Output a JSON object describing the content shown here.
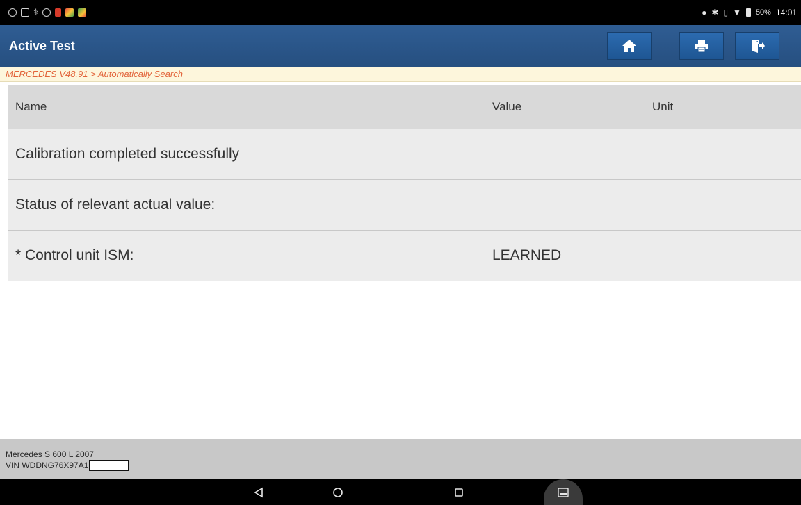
{
  "status_bar": {
    "left_icons": [
      "settings-icon",
      "screenshot-icon",
      "stethoscope-icon",
      "aperture-icon",
      "low-battery-icon",
      "app-icon",
      "app-icon"
    ],
    "right_icons": [
      "location-icon",
      "bluetooth-icon",
      "vibrate-icon",
      "wifi-icon",
      "battery-icon"
    ],
    "battery": "50%",
    "time": "14:01"
  },
  "header": {
    "title": "Active Test",
    "buttons": [
      "home-icon",
      "print-icon",
      "exit-icon"
    ]
  },
  "breadcrumb": "MERCEDES V48.91 > Automatically Search",
  "table": {
    "columns": [
      "Name",
      "Value",
      "Unit"
    ],
    "rows": [
      [
        "Calibration completed successfully",
        "",
        ""
      ],
      [
        "Status of relevant actual value:",
        "",
        ""
      ],
      [
        "* Control unit ISM:",
        "LEARNED",
        ""
      ]
    ]
  },
  "footer": {
    "vehicle": "Mercedes S 600 L 2007",
    "vin": "VIN WDDNG76X97A1"
  },
  "nav_bar": [
    "back-icon",
    "home-circle-icon",
    "recents-icon",
    "gallery-icon"
  ],
  "colors": {
    "header_bg": "#2a5687",
    "breadcrumb_text": "#e2633a",
    "breadcrumb_bg": "#fdf6dc",
    "table_header_bg": "#d9d9d9",
    "table_row_bg": "#ececec",
    "footer_bg": "#c8c8c8"
  }
}
